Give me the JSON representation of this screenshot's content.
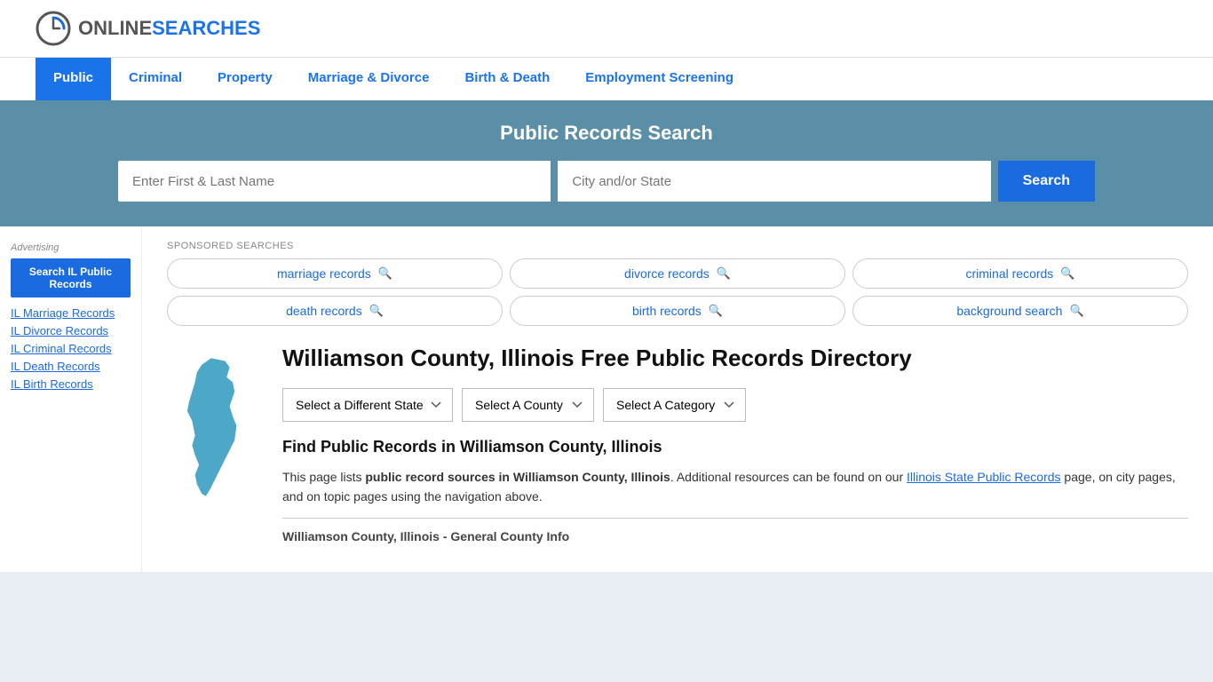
{
  "header": {
    "logo_online": "ONLINE",
    "logo_searches": "SEARCHES"
  },
  "nav": {
    "items": [
      {
        "id": "public",
        "label": "Public",
        "active": true
      },
      {
        "id": "criminal",
        "label": "Criminal",
        "active": false
      },
      {
        "id": "property",
        "label": "Property",
        "active": false
      },
      {
        "id": "marriage-divorce",
        "label": "Marriage & Divorce",
        "active": false
      },
      {
        "id": "birth-death",
        "label": "Birth & Death",
        "active": false
      },
      {
        "id": "employment",
        "label": "Employment Screening",
        "active": false
      }
    ]
  },
  "search_banner": {
    "title": "Public Records Search",
    "name_placeholder": "Enter First & Last Name",
    "location_placeholder": "City and/or State",
    "button_label": "Search"
  },
  "sponsored": {
    "label": "SPONSORED SEARCHES",
    "items": [
      {
        "id": "marriage",
        "text": "marriage records"
      },
      {
        "id": "divorce",
        "text": "divorce records"
      },
      {
        "id": "criminal",
        "text": "criminal records"
      },
      {
        "id": "death",
        "text": "death records"
      },
      {
        "id": "birth",
        "text": "birth records"
      },
      {
        "id": "background",
        "text": "background search"
      }
    ]
  },
  "county_page": {
    "title": "Williamson County, Illinois Free Public Records Directory",
    "dropdowns": {
      "state": "Select a Different State",
      "county": "Select A County",
      "category": "Select A Category"
    },
    "find_records_title": "Find Public Records in Williamson County, Illinois",
    "description": "This page lists public record sources in Williamson County, Illinois. Additional resources can be found on our Illinois State Public Records page, on city pages, and on topic pages using the navigation above.",
    "description_link_text": "Illinois State Public Records",
    "general_info_header": "Williamson County, Illinois - General County Info"
  },
  "sidebar": {
    "advertising_label": "Advertising",
    "promo_button": "Search IL Public Records",
    "links": [
      {
        "id": "marriage",
        "text": "IL Marriage Records"
      },
      {
        "id": "divorce",
        "text": "IL Divorce Records"
      },
      {
        "id": "criminal",
        "text": "IL Criminal Records"
      },
      {
        "id": "death",
        "text": "IL Death Records"
      },
      {
        "id": "birth",
        "text": "IL Birth Records"
      }
    ]
  },
  "colors": {
    "blue": "#1a6be0",
    "banner_bg": "#5b8fa8",
    "nav_active": "#1a73e8",
    "il_shape": "#4da8c7"
  }
}
